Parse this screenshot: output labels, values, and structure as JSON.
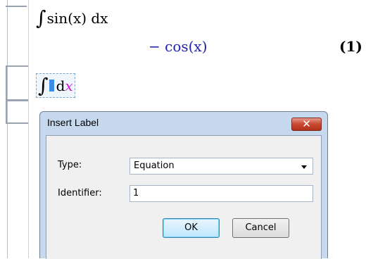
{
  "worksheet": {
    "expr1": {
      "integral_sign": "∫",
      "body": "sin(x) dx"
    },
    "result": {
      "text": "− cos(x)"
    },
    "eq_label": "(1)",
    "expr2": {
      "integral_sign": "∫",
      "d": "d",
      "x": "x"
    }
  },
  "dialog": {
    "title": "Insert Label",
    "close_glyph": "✕",
    "type_label": "Type:",
    "type_value": "Equation",
    "identifier_label": "Identifier:",
    "identifier_value": "1",
    "ok_label": "OK",
    "cancel_label": "Cancel"
  },
  "colors": {
    "result": "#1f1fb3",
    "x_variable": "#d11bd1",
    "placeholder": "#3a8ee6",
    "dialog_frame": "#c6d8ee"
  }
}
